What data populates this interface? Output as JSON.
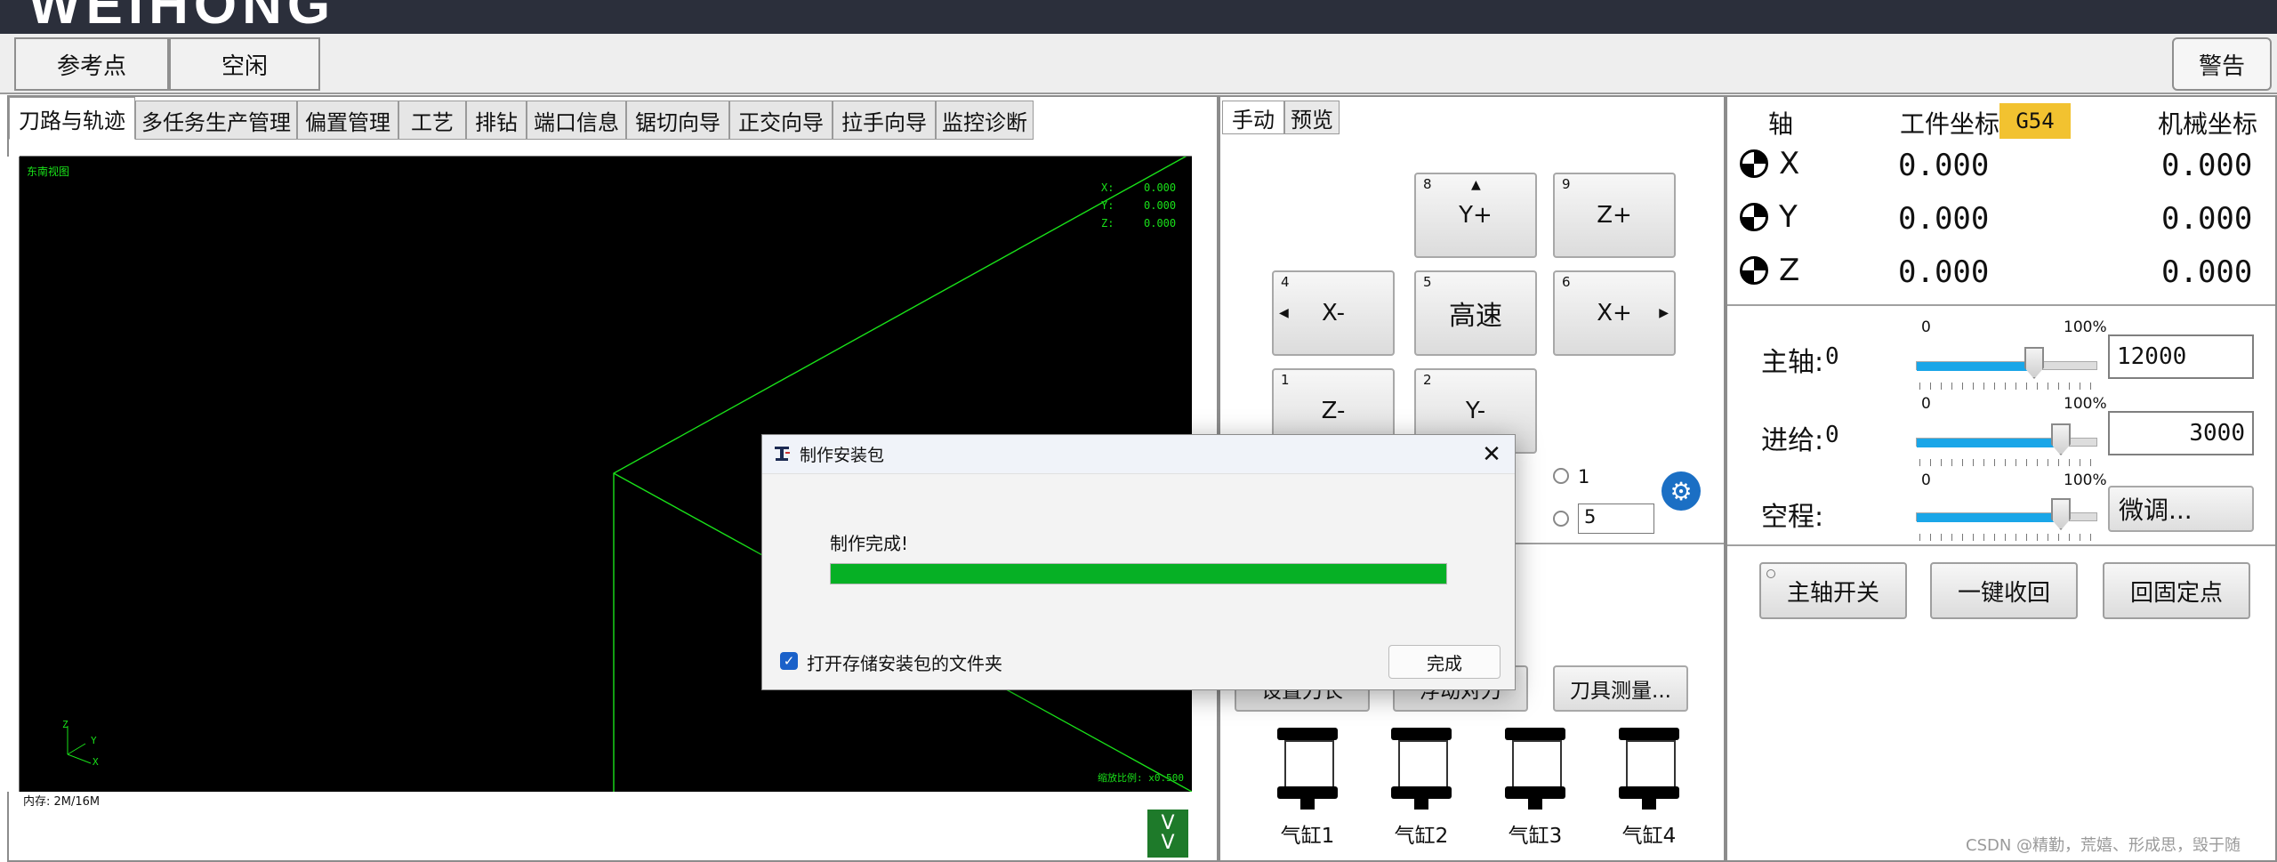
{
  "brand": {
    "logo": "WEIHONG"
  },
  "status_bar": {
    "ref_point": "参考点",
    "state": "空闲",
    "warning": "警告"
  },
  "left_tabs": [
    "刀路与轨迹",
    "多任务生产管理",
    "偏置管理",
    "工艺",
    "排钻",
    "端口信息",
    "锯切向导",
    "正交向导",
    "拉手向导",
    "监控诊断"
  ],
  "viewport": {
    "view_name": "东南视图",
    "coords": [
      {
        "axis": "X:",
        "value": "0.000"
      },
      {
        "axis": "Y:",
        "value": "0.000"
      },
      {
        "axis": "Z:",
        "value": "0.000"
      }
    ],
    "triad": {
      "x": "X",
      "y": "Y",
      "z": "Z"
    },
    "scale": "缩放比例: x0.500",
    "memory": "内存: 2M/16M",
    "scroll_glyph": "V\nV"
  },
  "center_tabs": [
    "手动",
    "预览"
  ],
  "jog": [
    {
      "num": "8",
      "label": "Y+"
    },
    {
      "num": "9",
      "label": "Z+"
    },
    {
      "num": "4",
      "label": "X-"
    },
    {
      "num": "5",
      "label": "高速"
    },
    {
      "num": "6",
      "label": "X+"
    },
    {
      "num": "1",
      "label": "Z-"
    },
    {
      "num": "2",
      "label": "Y-"
    }
  ],
  "step": {
    "opt1": "1",
    "opt2_value": "5"
  },
  "tool_buttons": {
    "set_length": "设置刀长",
    "float_set": "浮动对刀",
    "measure": "刀具测量..."
  },
  "cylinders": [
    "气缸1",
    "气缸2",
    "气缸3",
    "气缸4"
  ],
  "coords_panel": {
    "headers": {
      "axis": "轴",
      "work": "工件坐标",
      "machine": "机械坐标"
    },
    "wcs": "G54",
    "rows": [
      {
        "axis": "X",
        "work": "0.000",
        "machine": "0.000"
      },
      {
        "axis": "Y",
        "work": "0.000",
        "machine": "0.000"
      },
      {
        "axis": "Z",
        "work": "0.000",
        "machine": "0.000"
      }
    ]
  },
  "overrides": {
    "min_label": "0",
    "max_label": "100%",
    "spindle": {
      "label": "主轴:",
      "value": "0",
      "input": "12000",
      "level": 0.65
    },
    "feed": {
      "label": "进给:",
      "value": "0",
      "input": "3000",
      "level": 0.8
    },
    "rapid": {
      "label": "空程:",
      "input": "微调...",
      "level": 0.8
    }
  },
  "action_buttons": {
    "spindle_toggle": "主轴开关",
    "retract": "一键收回",
    "return_fixed": "回固定点"
  },
  "dialog": {
    "title": "制作安装包",
    "message": "制作完成!",
    "progress": 1.0,
    "checkbox_label": "打开存储安装包的文件夹",
    "done": "完成",
    "close_glyph": "✕"
  },
  "watermark": "CSDN @精勤，荒嬉、形成思，毁于随",
  "colors": {
    "accent_green": "#06b025",
    "slider_blue": "#1aa6e8",
    "wcs_tag": "#f2c230",
    "viewport_line": "#19e019"
  }
}
